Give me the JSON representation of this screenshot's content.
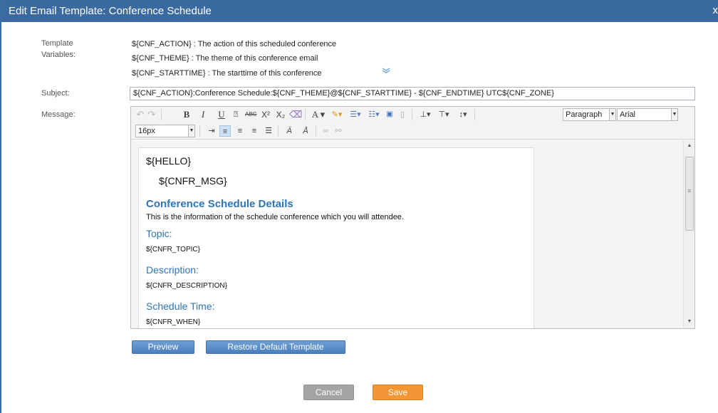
{
  "dialog": {
    "title": "Edit Email Template: Conference Schedule",
    "close_label": "x"
  },
  "variables": {
    "label_line1": "Template",
    "label_line2": "Variables:",
    "items": [
      "${CNF_ACTION} : The action of this scheduled conference",
      "${CNF_THEME} : The theme of this conference email",
      "${CNF_STARTTIME} : The starttime of this conference"
    ],
    "expand_icon": "double-chevron-down-icon"
  },
  "subject": {
    "label": "Subject:",
    "value": "${CNF_ACTION}:Conference Schedule:${CNF_THEME}@${CNF_STARTTIME} - ${CNF_ENDTIME} UTC${CNF_ZONE}"
  },
  "message": {
    "label": "Message:",
    "toolbar": {
      "format_value": "Paragraph",
      "font_value": "Arial",
      "size_value": "16px"
    },
    "body": {
      "hello": "${HELLO}",
      "msg": "${CNFR_MSG}",
      "heading": "Conference Schedule Details",
      "intro": "This is the information of the schedule conference which you will attendee.",
      "topic_label": "Topic:",
      "topic_value": "${CNFR_TOPIC}",
      "description_label": "Description:",
      "description_value": "${CNFR_DESCRIPTION}",
      "time_label": "Schedule Time:",
      "time_value": "${CNFR_WHEN}"
    },
    "heading_color": "#2e75b6"
  },
  "buttons": {
    "preview": "Preview",
    "restore": "Restore Default Template",
    "cancel": "Cancel",
    "save": "Save"
  },
  "colors": {
    "titlebar": "#3a6aa0",
    "primary_button": "#4a7fbd",
    "save": "#f29636",
    "cancel": "#a4a4a4"
  }
}
